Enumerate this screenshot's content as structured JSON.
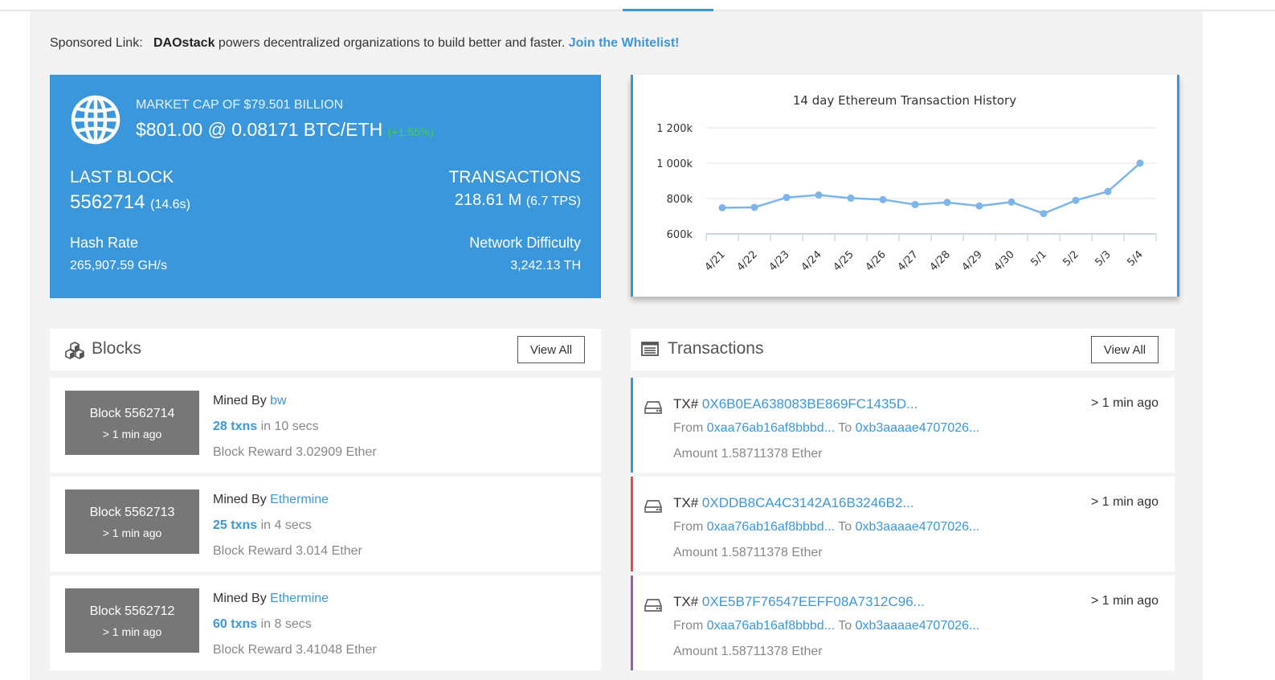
{
  "sponsor": {
    "prefix": "Sponsored Link:",
    "brand": "DAOstack",
    "text": " powers decentralized organizations to build better and faster. ",
    "cta": "Join the Whitelist!"
  },
  "stats": {
    "market_cap": "MARKET CAP OF $79.501 BILLION",
    "price": "$801.00 @ 0.08171 BTC/ETH",
    "change": "(+1.55%)",
    "last_block_label": "LAST BLOCK",
    "last_block_value": "5562714",
    "last_block_time": "(14.6s)",
    "transactions_label": "TRANSACTIONS",
    "transactions_value": "218.61 M",
    "transactions_tps": "(6.7 TPS)",
    "hash_rate_label": "Hash Rate",
    "hash_rate_value": "265,907.59 GH/s",
    "difficulty_label": "Network Difficulty",
    "difficulty_value": "3,242.13 TH"
  },
  "chart_data": {
    "type": "line",
    "title": "14 day Ethereum Transaction History",
    "categories": [
      "4/21",
      "4/22",
      "4/23",
      "4/24",
      "4/25",
      "4/26",
      "4/27",
      "4/28",
      "4/29",
      "4/30",
      "5/1",
      "5/2",
      "5/3",
      "5/4"
    ],
    "values": [
      748000,
      750000,
      806000,
      820000,
      802000,
      794000,
      766000,
      778000,
      758000,
      780000,
      715000,
      790000,
      840000,
      1000000
    ],
    "y_ticks": [
      600000,
      800000,
      1000000,
      1200000
    ],
    "y_tick_labels": [
      "600k",
      "800k",
      "1 000k",
      "1 200k"
    ],
    "ylim": [
      600000,
      1200000
    ],
    "grid": true,
    "color": "#7cb5ec"
  },
  "blocks": {
    "title": "Blocks",
    "view_all": "View All",
    "mined_by_label": "Mined By",
    "reward_label": "Block Reward",
    "items": [
      {
        "block": "Block 5562714",
        "ago": "> 1 min ago",
        "miner": "bw",
        "txns": "28 txns",
        "time": " in 10 secs",
        "reward": "3.02909 Ether"
      },
      {
        "block": "Block 5562713",
        "ago": "> 1 min ago",
        "miner": "Ethermine",
        "txns": "25 txns",
        "time": " in 4 secs",
        "reward": "3.014 Ether"
      },
      {
        "block": "Block 5562712",
        "ago": "> 1 min ago",
        "miner": "Ethermine",
        "txns": "60 txns",
        "time": " in 8 secs",
        "reward": "3.41048 Ether"
      }
    ]
  },
  "transactions": {
    "title": "Transactions",
    "view_all": "View All",
    "tx_label": "TX#",
    "from_label": "From",
    "to_label": "To",
    "amount_label": "Amount",
    "items": [
      {
        "hash": "0X6B0EA638083BE869FC1435D...",
        "from": "0xaa76ab16af8bbbd...",
        "to": "0xb3aaaae4707026...",
        "amount": "1.58711378 Ether",
        "ago": "> 1 min ago",
        "color": "#3b97dc"
      },
      {
        "hash": "0XDDB8CA4C3142A16B3246B2...",
        "from": "0xaa76ab16af8bbbd...",
        "to": "0xb3aaaae4707026...",
        "amount": "1.58711378 Ether",
        "ago": "> 1 min ago",
        "color": "#e74c3c"
      },
      {
        "hash": "0XE5B7F76547EEFF08A7312C96...",
        "from": "0xaa76ab16af8bbbd...",
        "to": "0xb3aaaae4707026...",
        "amount": "1.58711378 Ether",
        "ago": "> 1 min ago",
        "color": "#9b59b6"
      }
    ]
  }
}
